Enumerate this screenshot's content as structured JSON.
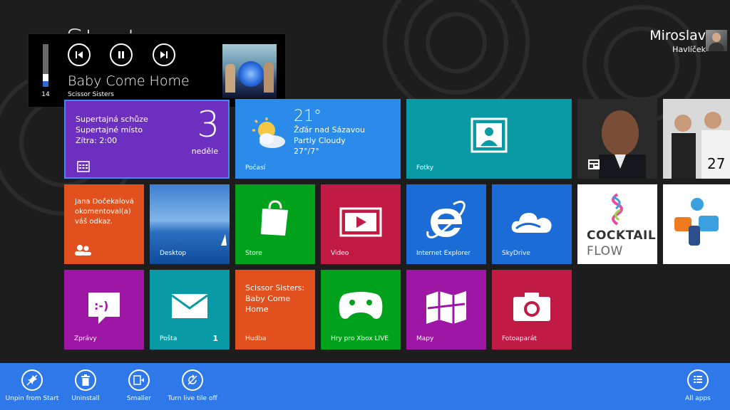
{
  "screen_title": "Start",
  "user": {
    "first_name": "Miroslav",
    "last_name": "Havlíček"
  },
  "media": {
    "volume": 14,
    "song": "Baby Come Home",
    "artist": "Scissor Sisters"
  },
  "tiles": {
    "calendar": {
      "line1": "Supertajná schůze",
      "line2": "Supertajné místo",
      "line3": "Zítra: 2:00",
      "day_number": "3",
      "day_name": "neděle"
    },
    "weather": {
      "temp": "21°",
      "city": "Žďár nad Sázavou",
      "condition": "Partly Cloudy",
      "range": "27°/7°",
      "label": "Počasí"
    },
    "photos": {
      "label": "Fotky"
    },
    "people": {
      "line1": "Jana Dočekalová",
      "line2": "okomentoval(a)",
      "line3": "váš odkaz."
    },
    "desktop": {
      "label": "Desktop"
    },
    "store": {
      "label": "Store"
    },
    "video": {
      "label": "Video"
    },
    "ie": {
      "label": "Internet Explorer"
    },
    "skydrive": {
      "label": "SkyDrive"
    },
    "cocktail": {
      "line1": "COCKTAIL",
      "line2": "FLOW"
    },
    "messaging": {
      "label": "Zprávy"
    },
    "mail": {
      "label": "Pošta",
      "badge": "1"
    },
    "music": {
      "line1": "Scissor Sisters:",
      "line2": "Baby Come",
      "line3": "Home",
      "label": "Hudba"
    },
    "xbox": {
      "label": "Hry pro Xbox LIVE"
    },
    "maps": {
      "label": "Mapy"
    },
    "camera": {
      "label": "Fotoaparát"
    }
  },
  "colors": {
    "appbar": "#2e78ea",
    "calendar": "#6d2fc0",
    "weather": "#2b8bea",
    "teal": "#0a9aa6",
    "orange": "#e1501d",
    "green": "#00a21b",
    "red": "#c01a45",
    "blue": "#1c6cd8",
    "purple": "#9d17a4"
  },
  "appbar": {
    "unpin": "Unpin from Start",
    "uninstall": "Uninstall",
    "smaller": "Smaller",
    "live_off": "Turn live tile off",
    "all_apps": "All apps"
  }
}
